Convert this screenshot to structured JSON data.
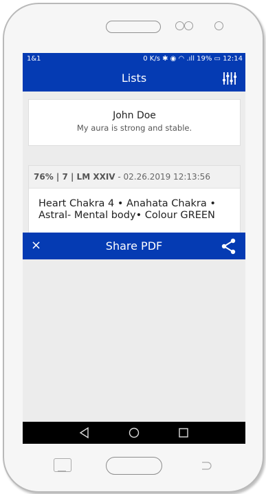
{
  "status_bar": {
    "carrier": "1&1",
    "indicators": "0 K/s ✱ ◉ ◠ .ıll 19% ▭ 12:14"
  },
  "app_bar": {
    "title": "Lists",
    "filter_icon": "sliders-icon"
  },
  "profile": {
    "name": "John Doe",
    "aura": "My aura is strong and stable."
  },
  "entry": {
    "stats": "76% | 7 | LM XXIV",
    "date": " - 02.26.2019 12:13:56",
    "body": "Heart Chakra 4 • Anahata Chakra • Astral- Mental body• Colour GREEN"
  },
  "share_bar": {
    "close_label": "×",
    "title": "Share PDF",
    "share_icon": "share-icon"
  },
  "colors": {
    "primary": "#053bb3",
    "screen_bg": "#ececec"
  }
}
